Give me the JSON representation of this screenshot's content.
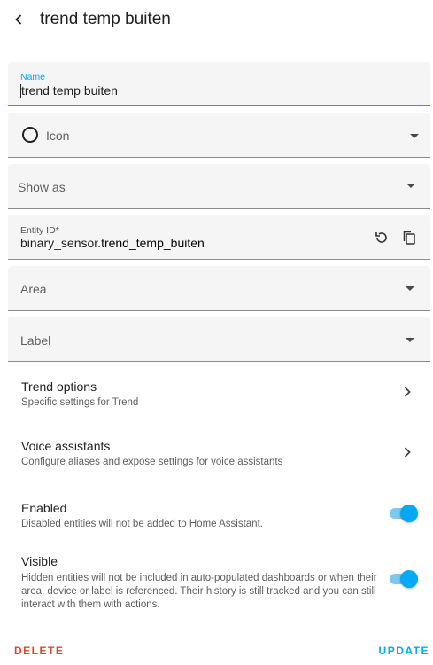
{
  "header": {
    "title": "trend temp buiten"
  },
  "fields": {
    "name": {
      "label": "Name",
      "value": "trend temp buiten"
    },
    "icon": {
      "placeholder": "Icon"
    },
    "show_as": {
      "placeholder": "Show as"
    },
    "entity_id": {
      "label": "Entity ID*",
      "prefix": "binary_sensor.",
      "suffix": "trend_temp_buiten"
    },
    "area": {
      "placeholder": "Area"
    },
    "label": {
      "placeholder": "Label"
    }
  },
  "rows": {
    "trend_options": {
      "title": "Trend options",
      "subtitle": "Specific settings for Trend"
    },
    "voice_assistants": {
      "title": "Voice assistants",
      "subtitle": "Configure aliases and expose settings for voice assistants"
    },
    "enabled": {
      "title": "Enabled",
      "subtitle": "Disabled entities will not be added to Home Assistant.",
      "on": true
    },
    "visible": {
      "title": "Visible",
      "subtitle": "Hidden entities will not be included in auto-populated dashboards or when their area, device or label is referenced. Their history is still tracked and you can still interact with them with actions.",
      "on": true
    }
  },
  "footer": {
    "delete_label": "DELETE",
    "update_label": "UPDATE"
  },
  "colors": {
    "accent": "#03a9f4",
    "danger": "#db4437"
  }
}
